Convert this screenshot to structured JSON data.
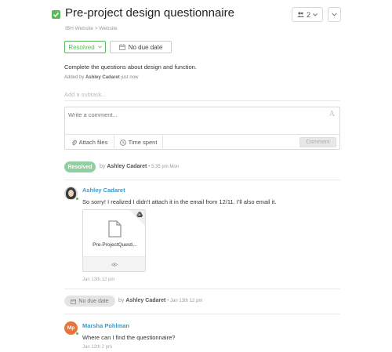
{
  "task": {
    "title": "Pre-project design questionnaire",
    "breadcrumb": "IBH Website > Website",
    "followers_count": "2",
    "status_label": "Resolved",
    "due_label": "No due date",
    "description": "Complete the questions about design and function.",
    "added_prefix": "Added by",
    "added_by": "Ashley Cadaret",
    "added_when": "just now",
    "subtask_placeholder": "Add a subtask..."
  },
  "comment_box": {
    "placeholder": "Write a comment...",
    "format_glyph": "A",
    "attach_label": "Attach files",
    "time_label": "Time spent",
    "submit_label": "Comment"
  },
  "activity": {
    "resolved_event": {
      "pill": "Resolved",
      "by": "by",
      "user": "Ashley Cadaret",
      "time": "• 5:35 pm Mon"
    },
    "comment1": {
      "author": "Ashley Cadaret",
      "text": "So sorry! I realized I didn't attach it in the email from 12/11. I'll also email it.",
      "file_name": "Pre-ProjectQuesti...",
      "date": "Jan 13th 12 pm"
    },
    "due_event": {
      "pill": "No due date",
      "by": "by",
      "user": "Ashley Cadaret",
      "time": "• Jan 13th 12 pm"
    },
    "comment2": {
      "author": "Marsha Pohlman",
      "initials": "Mp",
      "text": "Where can I find the questionnaire?",
      "date": "Jan 12th 2 pm"
    }
  },
  "colors": {
    "accent_green": "#5cb85c",
    "resolved_pill": "#8fd19e",
    "author_link": "#3a9bc9",
    "avatar_orange": "#e8743b"
  },
  "icons": [
    "checkbox-icon",
    "people-icon",
    "chevron-down-icon",
    "check-icon",
    "calendar-icon",
    "font-format-icon",
    "paperclip-icon",
    "clock-icon",
    "drive-icon",
    "document-icon",
    "eye-icon"
  ]
}
